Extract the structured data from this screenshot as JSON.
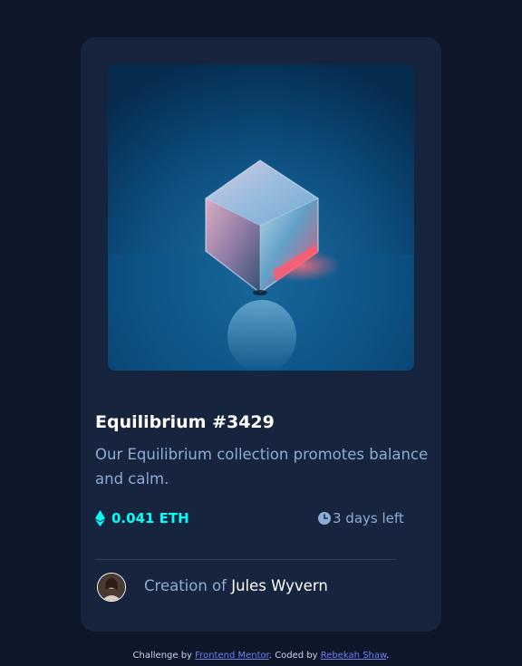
{
  "card": {
    "title": "Equilibrium #3429",
    "description": "Our Equilibrium collection promotes balance and calm.",
    "price": "0.041 ETH",
    "time_left": "3 days left",
    "creator_prefix": "Creation of",
    "creator_name": "Jules Wyvern"
  },
  "footer": {
    "challenge_by": "Challenge by",
    "frontend_mentor": "Frontend Mentor",
    "coded_by": ". Coded by",
    "author": "Rebekah Shaw",
    "end": "."
  },
  "icons": {
    "eth": "ethereum-icon",
    "clock": "clock-icon"
  },
  "colors": {
    "page_bg": "#0e1729",
    "card_bg": "#16243e",
    "accent_cyan": "#00fff8",
    "soft_blue": "#8bacd9",
    "divider": "#2e405a",
    "link": "#6b7ff0"
  }
}
